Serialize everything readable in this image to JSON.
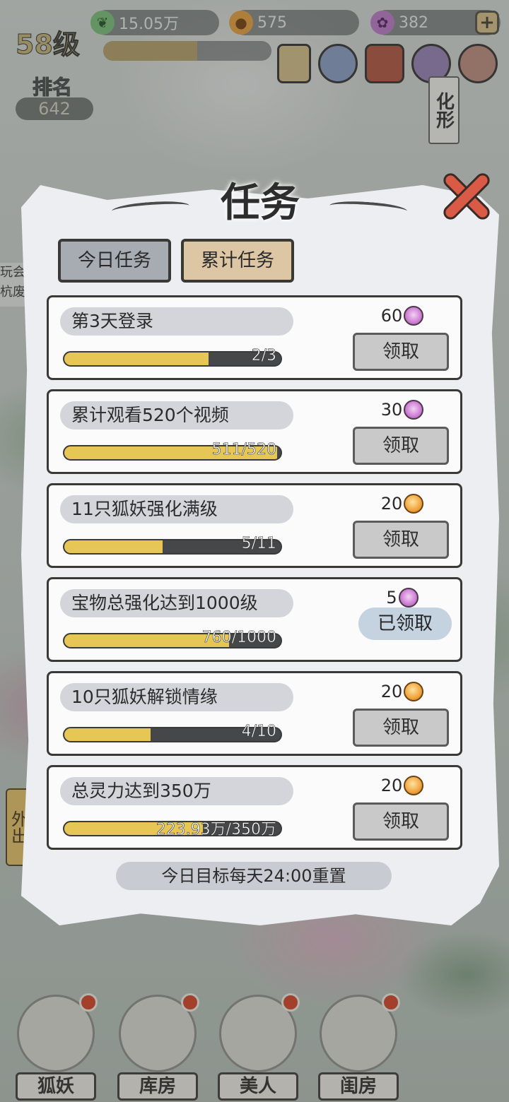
{
  "top_bar": {
    "resource_1": "15.05万",
    "resource_2": "575",
    "resource_3": "382",
    "level": "58级",
    "rank_label": "排名",
    "rank_value": "642",
    "transform_label": "化形"
  },
  "side": {
    "left_text": "玩会 杭废",
    "out_label": "外出"
  },
  "modal": {
    "title": "任务",
    "tabs": [
      {
        "label": "今日任务",
        "active": false
      },
      {
        "label": "累计任务",
        "active": true
      }
    ],
    "tasks": [
      {
        "name": "第3天登录",
        "progress_text": "2/3",
        "progress": 0.667,
        "reward": "60",
        "reward_icon": "gem-icon",
        "button": "领取",
        "claimed": false
      },
      {
        "name": "累计观看520个视频",
        "progress_text": "511/520",
        "progress": 0.983,
        "reward": "30",
        "reward_icon": "gem-icon",
        "button": "领取",
        "claimed": false
      },
      {
        "name": "11只狐妖强化满级",
        "progress_text": "5/11",
        "progress": 0.455,
        "reward": "20",
        "reward_icon": "coin-icon",
        "button": "领取",
        "claimed": false
      },
      {
        "name": "宝物总强化达到1000级",
        "progress_text": "760/1000",
        "progress": 0.76,
        "reward": "5",
        "reward_icon": "gem-icon",
        "button": "已领取",
        "claimed": true
      },
      {
        "name": "10只狐妖解锁情缘",
        "progress_text": "4/10",
        "progress": 0.4,
        "reward": "20",
        "reward_icon": "coin-icon",
        "button": "领取",
        "claimed": false
      },
      {
        "name": "总灵力达到350万",
        "progress_text": "223.93万/350万",
        "progress": 0.64,
        "reward": "20",
        "reward_icon": "coin-icon",
        "button": "领取",
        "claimed": false
      }
    ],
    "reset_note": "今日目标每天24:00重置"
  },
  "bottom_nav": [
    "狐妖",
    "库房",
    "美人",
    "闺房"
  ],
  "colors": {
    "progress_fill": "#e6c654",
    "progress_track": "#464749",
    "close_red": "#d95a45"
  }
}
